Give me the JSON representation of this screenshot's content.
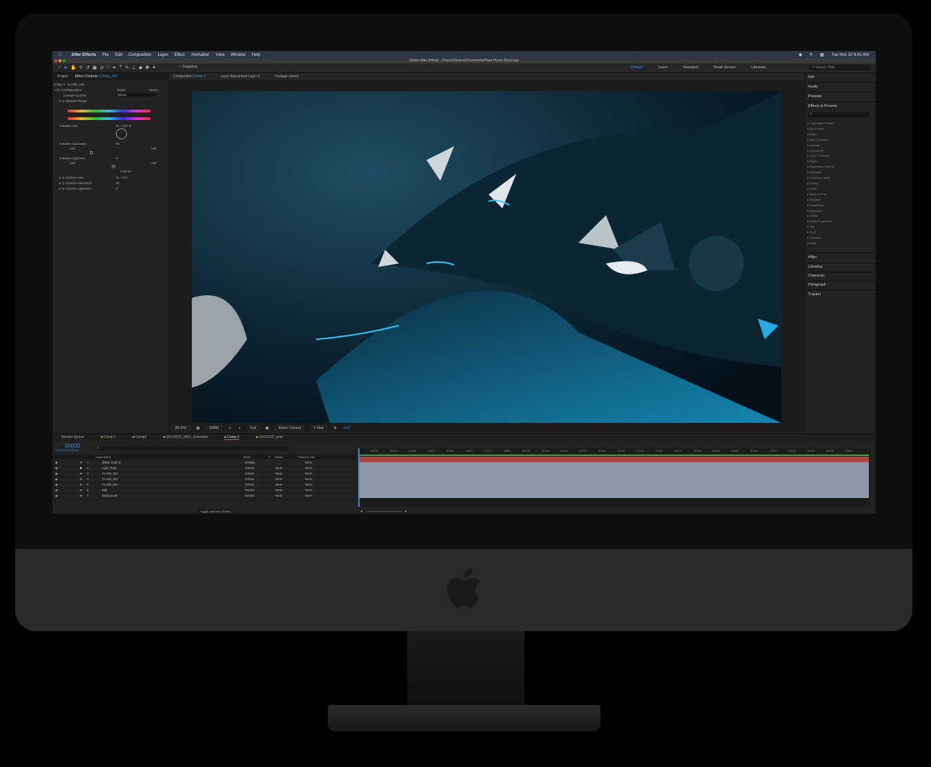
{
  "menubar": {
    "app_name": "After Effects",
    "items": [
      "File",
      "Edit",
      "Composition",
      "Layer",
      "Effect",
      "Animation",
      "View",
      "Window",
      "Help"
    ],
    "clock": "Tue Nov 10  9:41 AM"
  },
  "window_title": "Adobe After Effects - /Users/Dariene/Documents/Flare Power Burst.aep",
  "toolbar": {
    "snapping_label": "Snapping",
    "workspaces": [
      "Default",
      "Learn",
      "Standard",
      "Small Screen",
      "Libraries"
    ],
    "active_workspace": "Default",
    "search_help_placeholder": "Search Help"
  },
  "left_panel": {
    "tab_project": "Project",
    "tab_effect_controls": "Effect Controls",
    "layer_name": "FLARE_002",
    "breadcrumb": "Comp 3 · FLARE_002",
    "effect_name": "Hue/Saturation",
    "reset": "Reset",
    "about": "About...",
    "channel_control_label": "Channel Control",
    "channel_control_value": "Master",
    "channel_range": "Channel Range",
    "master_hue_label": "Master Hue",
    "master_hue_value": "0x + 237.0°",
    "master_saturation_label": "Master Saturation",
    "master_saturation_value": "62",
    "sat_min": "-100",
    "sat_max": "100",
    "master_lightness_label": "Master Lightness",
    "master_lightness_value": "0",
    "light_min": "-100",
    "light_max": "100",
    "colorize": "Colorize",
    "colorize_hue_label": "Colorize Hue",
    "colorize_hue_value": "0x + 0.0°",
    "colorize_saturation_label": "Colorize Saturation",
    "colorize_saturation_value": "25",
    "colorize_lightness_label": "Colorize Lightness",
    "colorize_lightness_value": "0"
  },
  "comp_panel": {
    "tab_composition": "Composition",
    "comp_name": "Comp 3",
    "tab_layer": "Layer Adjustment Layer 3",
    "tab_footage": "Footage (none)",
    "zoom": "(95.6%)",
    "timecode": "00000",
    "resolution": "Full",
    "camera": "Active Camera",
    "views": "1 View",
    "exposure": "+0.0"
  },
  "right_panel": {
    "sections_top": [
      "Info",
      "Audio",
      "Preview",
      "Effects & Presets"
    ],
    "effects_list": [
      "* Animation Presets",
      "3D Channel",
      "Audio",
      "Blur & Sharpen",
      "Channel",
      "Cinema 4D",
      "Color Correction",
      "Distort",
      "Expression Controls",
      "Generate",
      "Immersive Video",
      "Keying",
      "Matte",
      "Noise & Grain",
      "Obsolete",
      "Perspective",
      "Simulation",
      "Stylize",
      "Synthetic Aperture",
      "Text",
      "Time",
      "Transition",
      "Utility"
    ],
    "sections_bottom": [
      "Align",
      "Libraries",
      "Character",
      "Paragraph",
      "Tracker"
    ]
  },
  "timeline": {
    "tabs": [
      "Render Queue",
      "Comp 1",
      "Comp2",
      "20141022_0001_Extended",
      "Comp 3",
      "20141022_print"
    ],
    "active_tab": "Comp 3",
    "timecode": "00000",
    "timecode_sub": "0:00:00:00 (30.00 fps)",
    "header_layer_name": "Layer Name",
    "header_mode": "Mode",
    "header_t": "T",
    "header_trkmat": "TrkMat",
    "header_parent": "Parent & Link",
    "layers": [
      {
        "num": "1",
        "name": "[Black Solid 1]",
        "mode": "Multiply",
        "trkmat": "",
        "parent": "None",
        "color": "#a79ed6"
      },
      {
        "num": "2",
        "name": "Light_Rays",
        "mode": "Screen",
        "trkmat": "None",
        "parent": "None",
        "color": "#ffffff"
      },
      {
        "num": "3",
        "name": "FLARE_003",
        "mode": "Screen",
        "trkmat": "None",
        "parent": "None",
        "color": "#a79ed6"
      },
      {
        "num": "4",
        "name": "FLARE_002",
        "mode": "Screen",
        "trkmat": "None",
        "parent": "None",
        "color": "#a79ed6"
      },
      {
        "num": "5",
        "name": "FLARE_001",
        "mode": "Screen",
        "trkmat": "None",
        "parent": "None",
        "color": "#a79ed6"
      },
      {
        "num": "6",
        "name": "Ball",
        "mode": "Normal",
        "trkmat": "None",
        "parent": "None",
        "color": "#a79ed6"
      },
      {
        "num": "7",
        "name": "Background",
        "mode": "Normal",
        "trkmat": "None",
        "parent": "None",
        "color": "#a79ed6"
      }
    ],
    "ruler_ticks": [
      "00010",
      "00020",
      "00030",
      "00040",
      "00050",
      "00060",
      "00070",
      "00080",
      "00090",
      "00100",
      "00110",
      "00120",
      "00130",
      "00140",
      "00150",
      "00160",
      "00170",
      "00180",
      "00190",
      "00200",
      "00210",
      "00220",
      "00230",
      "00240",
      "00250",
      "00260"
    ],
    "toggle_label": "Toggle Switches / Modes"
  }
}
